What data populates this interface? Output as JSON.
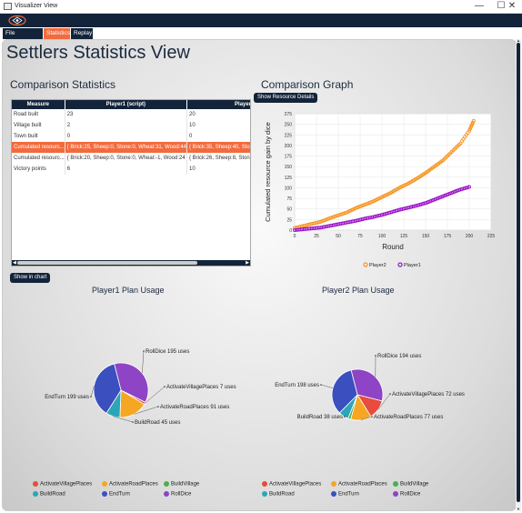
{
  "window": {
    "title": "Visualizer View",
    "minimize": "—",
    "maximize": "☐",
    "close": "✕"
  },
  "tabs": [
    {
      "label": "File Overview"
    },
    {
      "label": "Statistics"
    },
    {
      "label": "Replay"
    }
  ],
  "page": {
    "title": "Settlers Statistics View",
    "comparison_stats_title": "Comparison Statistics",
    "comparison_graph_title": "Comparison Graph",
    "show_resource_details": "Show Resource Details",
    "show_in_chart": "Show in chart",
    "player1_plan_title": "Player1 Plan Usage",
    "player2_plan_title": "Player2 Plan Usage"
  },
  "table": {
    "headers": [
      "Measure",
      "Player1 (script)",
      "Player2"
    ],
    "rows": [
      [
        "Road built",
        "23",
        "20"
      ],
      [
        "Village built",
        "2",
        "10"
      ],
      [
        "Town built",
        "0",
        "0"
      ],
      [
        "Cumulated resourc...",
        "{ Brick:25, Sheep:0, Stone:0, Wheat:31, Wood:44",
        "{ Brick:35, Sheep:40, Stone"
      ],
      [
        "Cumulated resourc...",
        "{ Brick:20, Sheep:0, Stone:0, Wheat:-1, Wood:24",
        "{ Brick:26, Sheep:8, Stone"
      ],
      [
        "Victory points",
        "6",
        "10"
      ]
    ],
    "selected_row": 3
  },
  "colors": {
    "navy": "#13243a",
    "accent": "#f26a3d",
    "player2": "#f7931e",
    "player1": "#9b11c9"
  },
  "chart_data": [
    {
      "type": "scatter",
      "xlabel": "Round",
      "ylabel": "Cumulated resource gain by dice",
      "xlim": [
        0,
        225
      ],
      "ylim": [
        0,
        275
      ],
      "x_ticks": [
        0,
        25,
        50,
        75,
        100,
        125,
        150,
        175,
        200,
        225
      ],
      "y_ticks": [
        0,
        25,
        50,
        75,
        100,
        125,
        150,
        175,
        200,
        225,
        250,
        275
      ],
      "grid": true,
      "legend_position": "bottom",
      "series": [
        {
          "name": "Player2",
          "color": "#f7931e",
          "x": [
            0,
            10,
            20,
            30,
            40,
            50,
            60,
            70,
            80,
            90,
            100,
            110,
            120,
            130,
            140,
            150,
            160,
            170,
            180,
            190,
            200,
            205
          ],
          "y": [
            5,
            10,
            15,
            20,
            28,
            35,
            42,
            52,
            60,
            68,
            78,
            88,
            100,
            110,
            122,
            135,
            150,
            165,
            185,
            205,
            235,
            258
          ]
        },
        {
          "name": "Player1",
          "color": "#9b11c9",
          "x": [
            0,
            10,
            20,
            30,
            40,
            50,
            60,
            70,
            80,
            90,
            100,
            110,
            120,
            130,
            140,
            150,
            160,
            170,
            180,
            190,
            200
          ],
          "y": [
            0,
            2,
            4,
            6,
            10,
            14,
            18,
            22,
            27,
            31,
            36,
            42,
            48,
            53,
            58,
            64,
            72,
            80,
            88,
            96,
            102
          ]
        }
      ]
    },
    {
      "type": "pie",
      "title": "Player1 Plan Usage",
      "slices": [
        {
          "label": "RollDice",
          "value": 195,
          "color": "#8e44c4",
          "text": "RollDice 195 uses"
        },
        {
          "label": "ActivateVillagePlaces",
          "value": 7,
          "color": "#e74c3c",
          "text": "ActivateVillagePlaces 7 uses"
        },
        {
          "label": "ActivateRoadPlaces",
          "value": 91,
          "color": "#f5a623",
          "text": "ActivateRoadPlaces 91 uses"
        },
        {
          "label": "BuildRoad",
          "value": 45,
          "color": "#2ba6b8",
          "text": "BuildRoad 45 uses"
        },
        {
          "label": "EndTurn",
          "value": 199,
          "color": "#3b4fbf",
          "text": "EndTurn 199 uses"
        }
      ]
    },
    {
      "type": "pie",
      "title": "Player2 Plan Usage",
      "slices": [
        {
          "label": "RollDice",
          "value": 194,
          "color": "#8e44c4",
          "text": "RollDice 194 uses"
        },
        {
          "label": "ActivateVillagePlaces",
          "value": 72,
          "color": "#e74c3c",
          "text": "ActivateVillagePlaces 72 uses"
        },
        {
          "label": "ActivateRoadPlaces",
          "value": 77,
          "color": "#f5a623",
          "text": "ActivateRoadPlaces 77 uses"
        },
        {
          "label": "BuildVillage",
          "value": 10,
          "color": "#4caf50",
          "text": ""
        },
        {
          "label": "BuildRoad",
          "value": 38,
          "color": "#2ba6b8",
          "text": "BuildRoad 38 uses"
        },
        {
          "label": "EndTurn",
          "value": 198,
          "color": "#3b4fbf",
          "text": "EndTurn 198 uses"
        }
      ]
    }
  ],
  "pie_legend": [
    {
      "label": "ActivateVillagePlaces",
      "color": "#e74c3c"
    },
    {
      "label": "ActivateRoadPlaces",
      "color": "#f5a623"
    },
    {
      "label": "BuildVillage",
      "color": "#4caf50"
    },
    {
      "label": "BuildRoad",
      "color": "#2ba6b8"
    },
    {
      "label": "EndTurn",
      "color": "#3b4fbf"
    },
    {
      "label": "RollDice",
      "color": "#8e44c4"
    }
  ]
}
